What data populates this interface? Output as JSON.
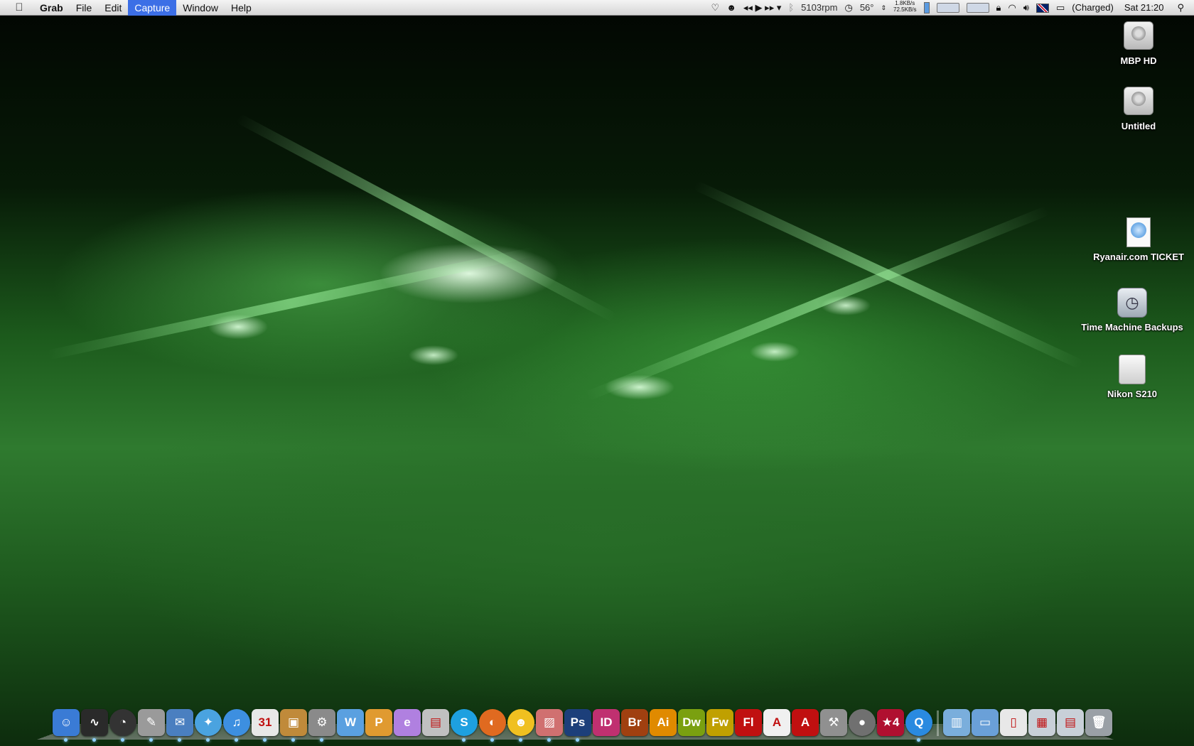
{
  "menubar": {
    "app_name": "Grab",
    "menus": [
      "File",
      "Edit",
      "Capture",
      "Window",
      "Help"
    ],
    "active_menu": "Capture",
    "status": {
      "fan_speed": "5103rpm",
      "temperature": "56°",
      "net_up": "1.8KB/s",
      "net_down": "72.5KB/s",
      "battery": "(Charged)",
      "clock": "Sat 21:20"
    }
  },
  "desktop_icons": [
    {
      "label": "MBP HD",
      "icon": "hard-drive-icon"
    },
    {
      "label": "Untitled",
      "icon": "hard-drive-icon"
    },
    {
      "label": "Ryanair.com TICKET",
      "icon": "safari-archive-icon"
    },
    {
      "label": "Time Machine Backups",
      "icon": "time-machine-icon"
    },
    {
      "label": "Nikon S210",
      "icon": "external-drive-icon"
    }
  ],
  "dock": {
    "apps": [
      {
        "name": "finder",
        "glyph": "☺",
        "color": "#3a7bd5"
      },
      {
        "name": "activity-monitor",
        "glyph": "∿",
        "color": "#2a2a2a"
      },
      {
        "name": "dashboard",
        "glyph": "◔",
        "color": "#333333"
      },
      {
        "name": "script-editor",
        "glyph": "✎",
        "color": "#9a9a9a"
      },
      {
        "name": "mail",
        "glyph": "✉",
        "color": "#4a7fc0"
      },
      {
        "name": "safari",
        "glyph": "✦",
        "color": "#4aa3e0"
      },
      {
        "name": "itunes",
        "glyph": "♫",
        "color": "#3d8fe0"
      },
      {
        "name": "ical",
        "glyph": "31",
        "color": "#e8e8e8"
      },
      {
        "name": "iphoto",
        "glyph": "▣",
        "color": "#c08a3a"
      },
      {
        "name": "system-preferences",
        "glyph": "⚙",
        "color": "#8a8a8a"
      },
      {
        "name": "word",
        "glyph": "W",
        "color": "#5aa0e0"
      },
      {
        "name": "powerpoint",
        "glyph": "P",
        "color": "#e09a30"
      },
      {
        "name": "entourage",
        "glyph": "e",
        "color": "#b080e0"
      },
      {
        "name": "stuffit",
        "glyph": "▤",
        "color": "#c0c0c0"
      },
      {
        "name": "skype",
        "glyph": "S",
        "color": "#1ea0e0"
      },
      {
        "name": "firefox",
        "glyph": "◐",
        "color": "#e06a20"
      },
      {
        "name": "adium",
        "glyph": "☻",
        "color": "#f0c020"
      },
      {
        "name": "preview",
        "glyph": "▨",
        "color": "#d07070"
      },
      {
        "name": "photoshop",
        "glyph": "Ps",
        "color": "#1c3f7a"
      },
      {
        "name": "indesign",
        "glyph": "ID",
        "color": "#c03070"
      },
      {
        "name": "bridge",
        "glyph": "Br",
        "color": "#a04010"
      },
      {
        "name": "illustrator",
        "glyph": "Ai",
        "color": "#e08a00"
      },
      {
        "name": "dreamweaver",
        "glyph": "Dw",
        "color": "#7aa010"
      },
      {
        "name": "fireworks",
        "glyph": "Fw",
        "color": "#c0a000"
      },
      {
        "name": "flash",
        "glyph": "Fl",
        "color": "#c01010"
      },
      {
        "name": "acrobat-pro",
        "glyph": "A",
        "color": "#f0f0f0"
      },
      {
        "name": "acrobat",
        "glyph": "A",
        "color": "#c01010"
      },
      {
        "name": "automator",
        "glyph": "⚒",
        "color": "#909090"
      },
      {
        "name": "moon-app",
        "glyph": "●",
        "color": "#707070"
      },
      {
        "name": "star-app",
        "glyph": "★4",
        "color": "#b01030"
      },
      {
        "name": "quicktime",
        "glyph": "Q",
        "color": "#2a8ae0"
      }
    ],
    "stacks": [
      {
        "name": "applications-stack",
        "glyph": "▥",
        "color": "#7aaedc"
      },
      {
        "name": "documents-folder",
        "glyph": "▭",
        "color": "#6aa0d8"
      },
      {
        "name": "dock-document",
        "glyph": "▯",
        "color": "#e8e8e8"
      },
      {
        "name": "downloads-stack",
        "glyph": "▦",
        "color": "#c8d0d8"
      },
      {
        "name": "window-stack",
        "glyph": "▤",
        "color": "#c8d0d8"
      },
      {
        "name": "trash",
        "glyph": "🗑",
        "color": "#9aa0a6"
      }
    ]
  }
}
